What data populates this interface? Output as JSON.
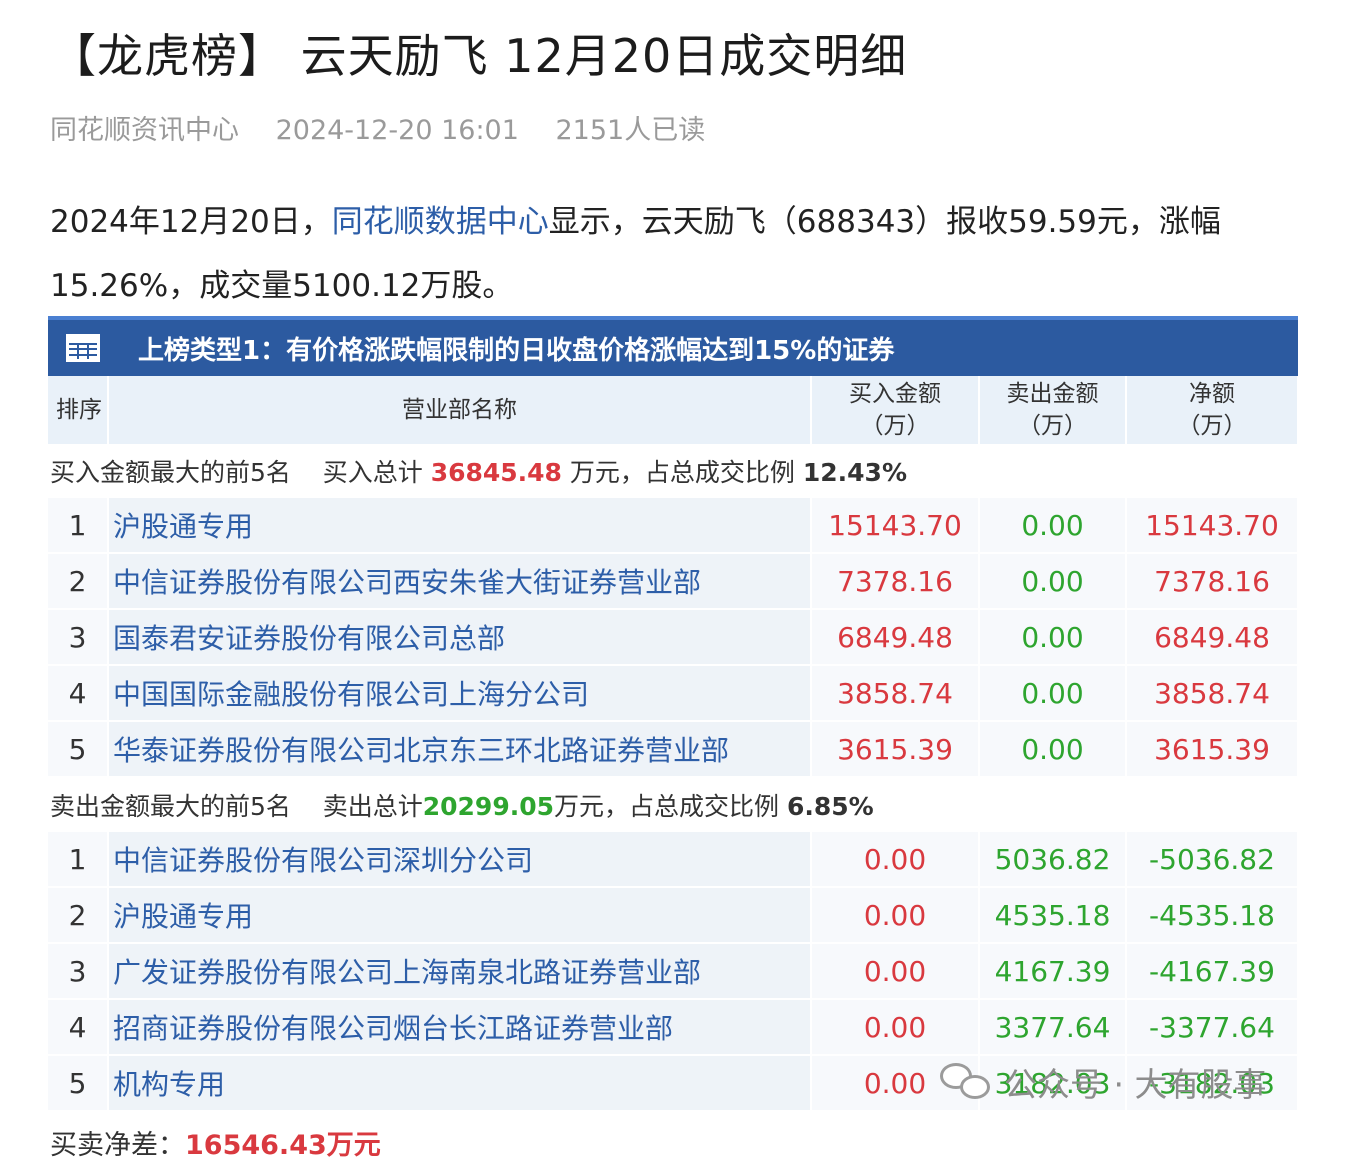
{
  "article": {
    "title": "【龙虎榜】 云天励飞 12月20日成交明细",
    "source": "同花顺资讯中心",
    "datetime": "2024-12-20 16:01",
    "reads": "2151人已读",
    "summary_part1": "2024年12月20日，",
    "summary_link": "同花顺数据中心",
    "summary_part2": "显示，云天励飞（688343）报收59.59元，涨幅15.26%，成交量5100.12万股。"
  },
  "table": {
    "banner": "上榜类型1：有价格涨跌幅限制的日收盘价格涨幅达到15%的证券",
    "headers": {
      "rank": "排序",
      "name": "营业部名称",
      "buy": "买入金额（万）",
      "sell": "卖出金额（万）",
      "net": "净额（万）"
    },
    "buy_section": {
      "label": "买入金额最大的前5名",
      "total_label": "买入总计",
      "total_value": "36845.48",
      "total_unit": "万元，占总成交比例",
      "ratio": "12.43%"
    },
    "buy_rows": [
      {
        "rank": "1",
        "name": "沪股通专用",
        "buy": "15143.70",
        "sell": "0.00",
        "net": "15143.70"
      },
      {
        "rank": "2",
        "name": "中信证券股份有限公司西安朱雀大街证券营业部",
        "buy": "7378.16",
        "sell": "0.00",
        "net": "7378.16"
      },
      {
        "rank": "3",
        "name": "国泰君安证券股份有限公司总部",
        "buy": "6849.48",
        "sell": "0.00",
        "net": "6849.48"
      },
      {
        "rank": "4",
        "name": "中国国际金融股份有限公司上海分公司",
        "buy": "3858.74",
        "sell": "0.00",
        "net": "3858.74"
      },
      {
        "rank": "5",
        "name": "华泰证券股份有限公司北京东三环北路证券营业部",
        "buy": "3615.39",
        "sell": "0.00",
        "net": "3615.39"
      }
    ],
    "sell_section": {
      "label": "卖出金额最大的前5名",
      "total_label": "卖出总计",
      "total_value": "20299.05",
      "total_unit": "万元，占总成交比例",
      "ratio": "6.85%"
    },
    "sell_rows": [
      {
        "rank": "1",
        "name": "中信证券股份有限公司深圳分公司",
        "buy": "0.00",
        "sell": "5036.82",
        "net": "-5036.82"
      },
      {
        "rank": "2",
        "name": "沪股通专用",
        "buy": "0.00",
        "sell": "4535.18",
        "net": "-4535.18"
      },
      {
        "rank": "3",
        "name": "广发证券股份有限公司上海南泉北路证券营业部",
        "buy": "0.00",
        "sell": "4167.39",
        "net": "-4167.39"
      },
      {
        "rank": "4",
        "name": "招商证券股份有限公司烟台长江路证券营业部",
        "buy": "0.00",
        "sell": "3377.64",
        "net": "-3377.64"
      },
      {
        "rank": "5",
        "name": "机构专用",
        "buy": "0.00",
        "sell": "3182.03",
        "net": "-3182.03"
      }
    ],
    "footer": {
      "label": "买卖净差：",
      "value": "16546.43万元"
    }
  },
  "watermark": "公众号 · 大有股事",
  "icons": {
    "banner": "table-grid-icon",
    "watermark": "wechat-icon"
  },
  "colors": {
    "banner": "#2c5aa0",
    "positive": "#d9393f",
    "negative": "#2ea52f",
    "link": "#2d5ea8"
  }
}
